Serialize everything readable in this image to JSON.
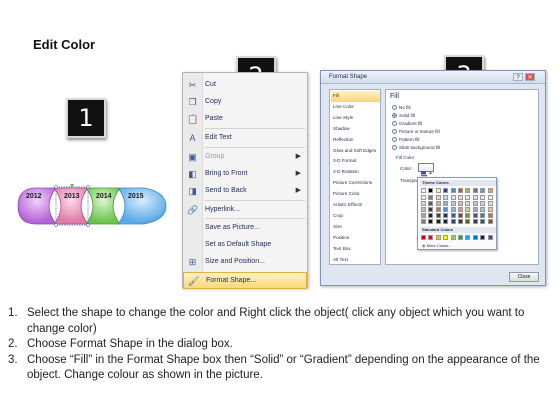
{
  "page": {
    "title": "Edit Color"
  },
  "steps": [
    "1",
    "2",
    "3"
  ],
  "timeline": {
    "items": [
      {
        "year": "2012",
        "color": "#b564d6"
      },
      {
        "year": "2013",
        "color": "#e07aa8"
      },
      {
        "year": "2014",
        "color": "#6cc44c"
      },
      {
        "year": "2015",
        "color": "#5aa9e6"
      }
    ]
  },
  "context_menu": {
    "items": [
      {
        "label": "Cut",
        "icon": "scissors-icon",
        "glyph": "✂"
      },
      {
        "label": "Copy",
        "icon": "copy-icon",
        "glyph": "❐"
      },
      {
        "label": "Paste",
        "icon": "paste-icon",
        "glyph": "📋"
      },
      {
        "label": "Edit Text",
        "icon": "edit-text-icon",
        "glyph": "A"
      },
      {
        "label": "Group",
        "icon": "group-icon",
        "glyph": "▣",
        "disabled": true,
        "submenu": true
      },
      {
        "label": "Bring to Front",
        "icon": "bring-front-icon",
        "glyph": "◧",
        "submenu": true
      },
      {
        "label": "Send to Back",
        "icon": "send-back-icon",
        "glyph": "◨",
        "submenu": true
      },
      {
        "label": "Hyperlink...",
        "icon": "hyperlink-icon",
        "glyph": "🔗"
      },
      {
        "label": "Save as Picture...",
        "icon": "",
        "glyph": ""
      },
      {
        "label": "Set as Default Shape",
        "icon": "",
        "glyph": ""
      },
      {
        "label": "Size and Position...",
        "icon": "size-position-icon",
        "glyph": "⊞"
      },
      {
        "label": "Format Shape...",
        "icon": "format-shape-icon",
        "glyph": "🖌",
        "highlight": true
      }
    ]
  },
  "dialog": {
    "title": "Format Shape",
    "controls": {
      "help": "?",
      "close": "✕"
    },
    "nav": [
      "Fill",
      "Line Color",
      "Line Style",
      "Shadow",
      "Reflection",
      "Glow and Soft Edges",
      "3-D Format",
      "3-D Rotation",
      "Picture Corrections",
      "Picture Color",
      "Artistic Effects",
      "Crop",
      "Size",
      "Position",
      "Text Box",
      "Alt Text"
    ],
    "active_nav": "Fill",
    "fill_heading": "Fill",
    "options": [
      "No fill",
      "Solid fill",
      "Gradient fill",
      "Picture or texture fill",
      "Pattern fill",
      "Slide background fill"
    ],
    "selected_option": "Solid fill",
    "fill_color_label": "Fill Color",
    "color_label": "Color:",
    "transparency_label": "Transparency:",
    "close_label": "Close",
    "picker": {
      "theme_heading": "Theme Colors",
      "standard_heading": "Standard Colors",
      "more_label": "More Colors...",
      "theme_top": [
        "#ffffff",
        "#000000",
        "#eeece1",
        "#1f497d",
        "#4f81bd",
        "#c0504d",
        "#9bbb59",
        "#8064a2",
        "#4bacc6",
        "#f79646"
      ],
      "theme_shades": [
        [
          "#f2f2f2",
          "#7f7f7f",
          "#ddd9c3",
          "#c6d9f0",
          "#dbe5f1",
          "#f2dcdb",
          "#ebf1dd",
          "#e5e0ec",
          "#dbeef3",
          "#fdeada"
        ],
        [
          "#d8d8d8",
          "#595959",
          "#c4bd97",
          "#8db3e2",
          "#b8cce4",
          "#e5b9b7",
          "#d7e3bc",
          "#ccc1d9",
          "#b7dde8",
          "#fbd5b5"
        ],
        [
          "#bfbfbf",
          "#3f3f3f",
          "#938953",
          "#548dd4",
          "#95b3d7",
          "#d99694",
          "#c3d69b",
          "#b2a2c7",
          "#92cddc",
          "#fac08f"
        ],
        [
          "#a5a5a5",
          "#262626",
          "#494429",
          "#17365d",
          "#366092",
          "#953734",
          "#76923c",
          "#5f497a",
          "#31859b",
          "#e36c09"
        ],
        [
          "#7f7f7f",
          "#0c0c0c",
          "#1d1b10",
          "#0f243e",
          "#244061",
          "#632423",
          "#4f6128",
          "#3f3151",
          "#205867",
          "#974806"
        ]
      ],
      "standard": [
        "#c00000",
        "#ff0000",
        "#ffc000",
        "#ffff00",
        "#92d050",
        "#00b050",
        "#00b0f0",
        "#0070c0",
        "#002060",
        "#7030a0"
      ]
    }
  },
  "instructions": [
    {
      "num": "1.",
      "text": "Select the shape to change the color and Right click the object( click any object which you want to change color)"
    },
    {
      "num": "2.",
      "text": "Choose Format Shape in the dialog box."
    },
    {
      "num": "3.",
      "text": "Choose “Fill” in the Format Shape box then “Solid” or “Gradient” depending on the appearance of the object. Change colour as shown in the picture."
    }
  ]
}
